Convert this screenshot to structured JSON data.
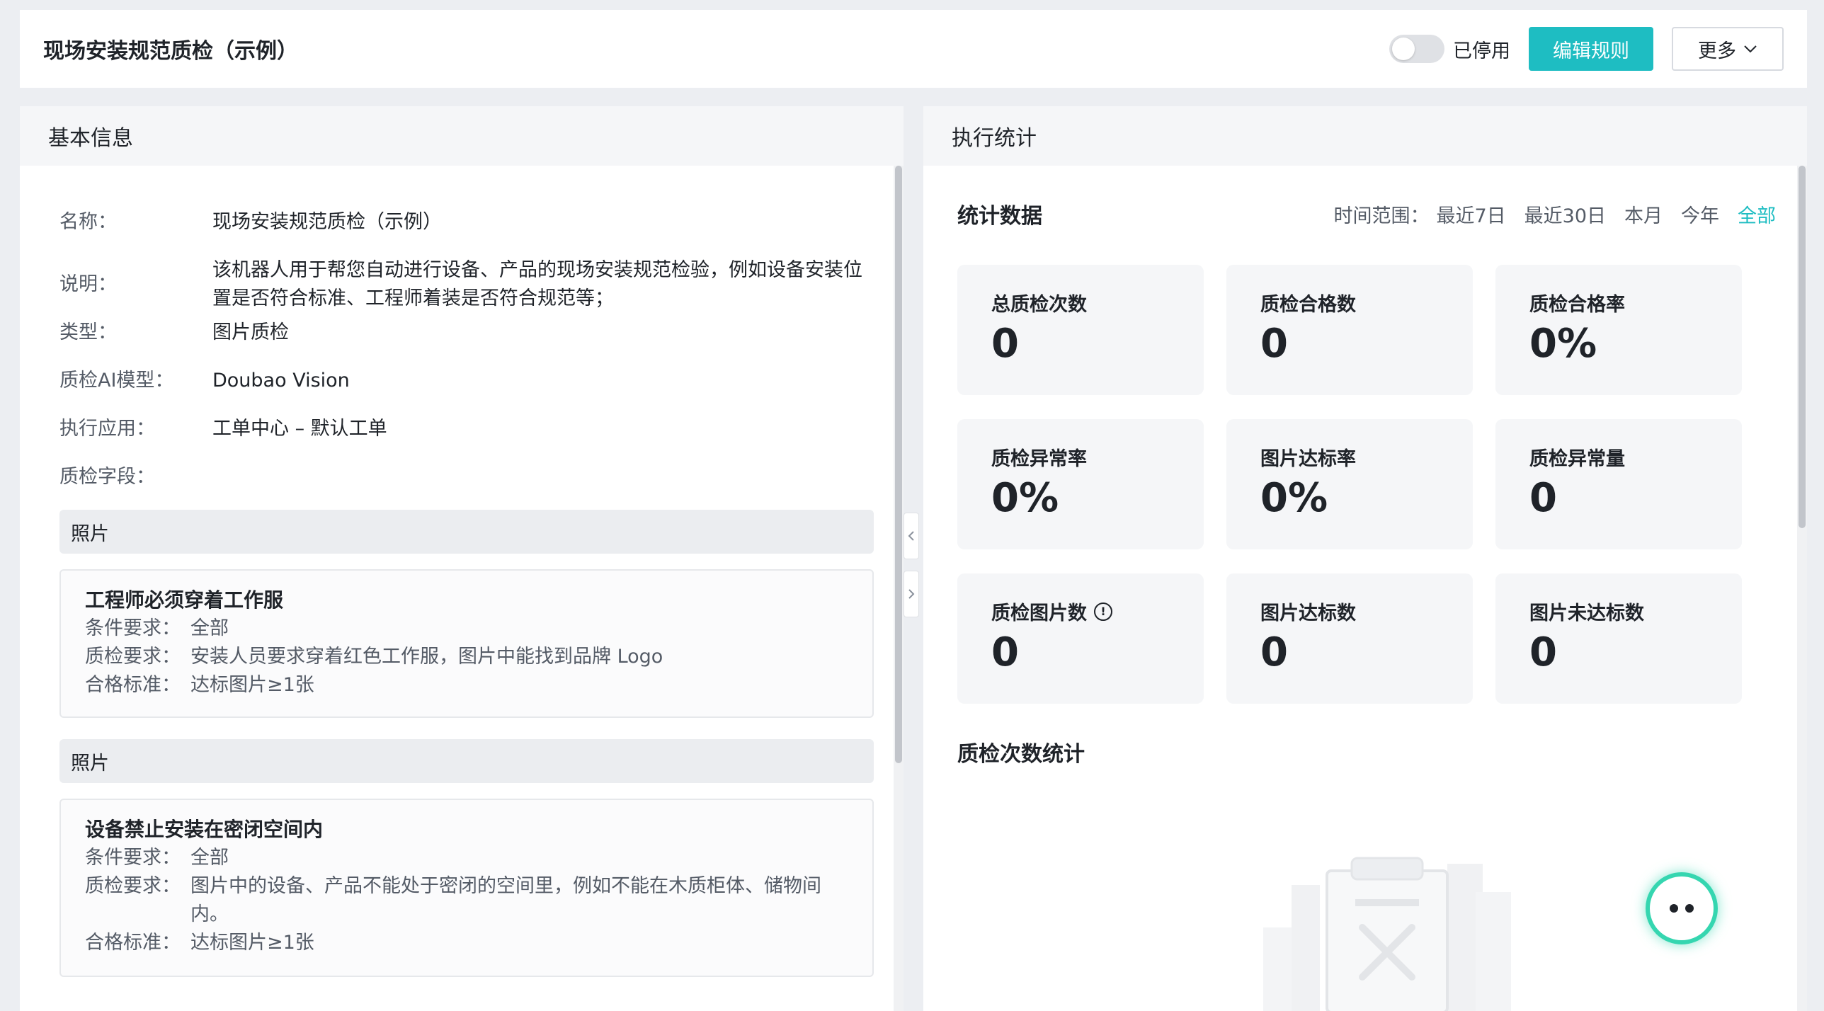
{
  "header": {
    "title": "现场安装规范质检（示例）",
    "toggle_label": "已停用",
    "toggle_on": false,
    "edit_button": "编辑规则",
    "more_button": "更多"
  },
  "basic_info": {
    "panel_title": "基本信息",
    "rows": [
      {
        "label": "名称：",
        "value": "现场安装规范质检（示例）"
      },
      {
        "label": "说明：",
        "value": "该机器人用于帮您自动进行设备、产品的现场安装规范检验，例如设备安装位置是否符合标准、工程师着装是否符合规范等；"
      },
      {
        "label": "类型：",
        "value": "图片质检"
      },
      {
        "label": "质检AI模型：",
        "value": "Doubao Vision"
      },
      {
        "label": "执行应用：",
        "value": "工单中心 – 默认工单"
      },
      {
        "label": "质检字段：",
        "value": ""
      }
    ],
    "fields": [
      {
        "name": "照片",
        "rule_title": "工程师必须穿着工作服",
        "condition_label": "条件要求：",
        "condition": "全部",
        "requirement_label": "质检要求：",
        "requirement": "安装人员要求穿着红色工作服，图片中能找到品牌 Logo",
        "standard_label": "合格标准：",
        "standard": "达标图片≥1张"
      },
      {
        "name": "照片",
        "rule_title": "设备禁止安装在密闭空间内",
        "condition_label": "条件要求：",
        "condition": "全部",
        "requirement_label": "质检要求：",
        "requirement": "图片中的设备、产品不能处于密闭的空间里，例如不能在木质柜体、储物间内。",
        "standard_label": "合格标准：",
        "standard": "达标图片≥1张"
      }
    ]
  },
  "execution": {
    "panel_title": "执行统计",
    "stats_title": "统计数据",
    "range_label": "时间范围：",
    "range_options": [
      "最近7日",
      "最近30日",
      "本月",
      "今年",
      "全部"
    ],
    "range_active": "全部",
    "cards": [
      {
        "label": "总质检次数",
        "value": "0"
      },
      {
        "label": "质检合格数",
        "value": "0"
      },
      {
        "label": "质检合格率",
        "value": "0%"
      },
      {
        "label": "质检异常率",
        "value": "0%"
      },
      {
        "label": "图片达标率",
        "value": "0%"
      },
      {
        "label": "质检异常量",
        "value": "0"
      },
      {
        "label": "质检图片数",
        "value": "0"
      },
      {
        "label": "图片达标数",
        "value": "0"
      },
      {
        "label": "图片未达标数",
        "value": "0"
      }
    ],
    "count_section_title": "质检次数统计"
  },
  "icons": {
    "more_chevron": "chevron-down-icon",
    "collapse_left": "chevron-left-icon",
    "collapse_right": "chevron-right-icon",
    "info": "info-circle-icon",
    "assistant": "assistant-bot-icon"
  },
  "colors": {
    "accent": "#1ebdc2",
    "background": "#eceef2",
    "card": "#f5f6f8",
    "assistant_ring": "#35d6b0"
  }
}
